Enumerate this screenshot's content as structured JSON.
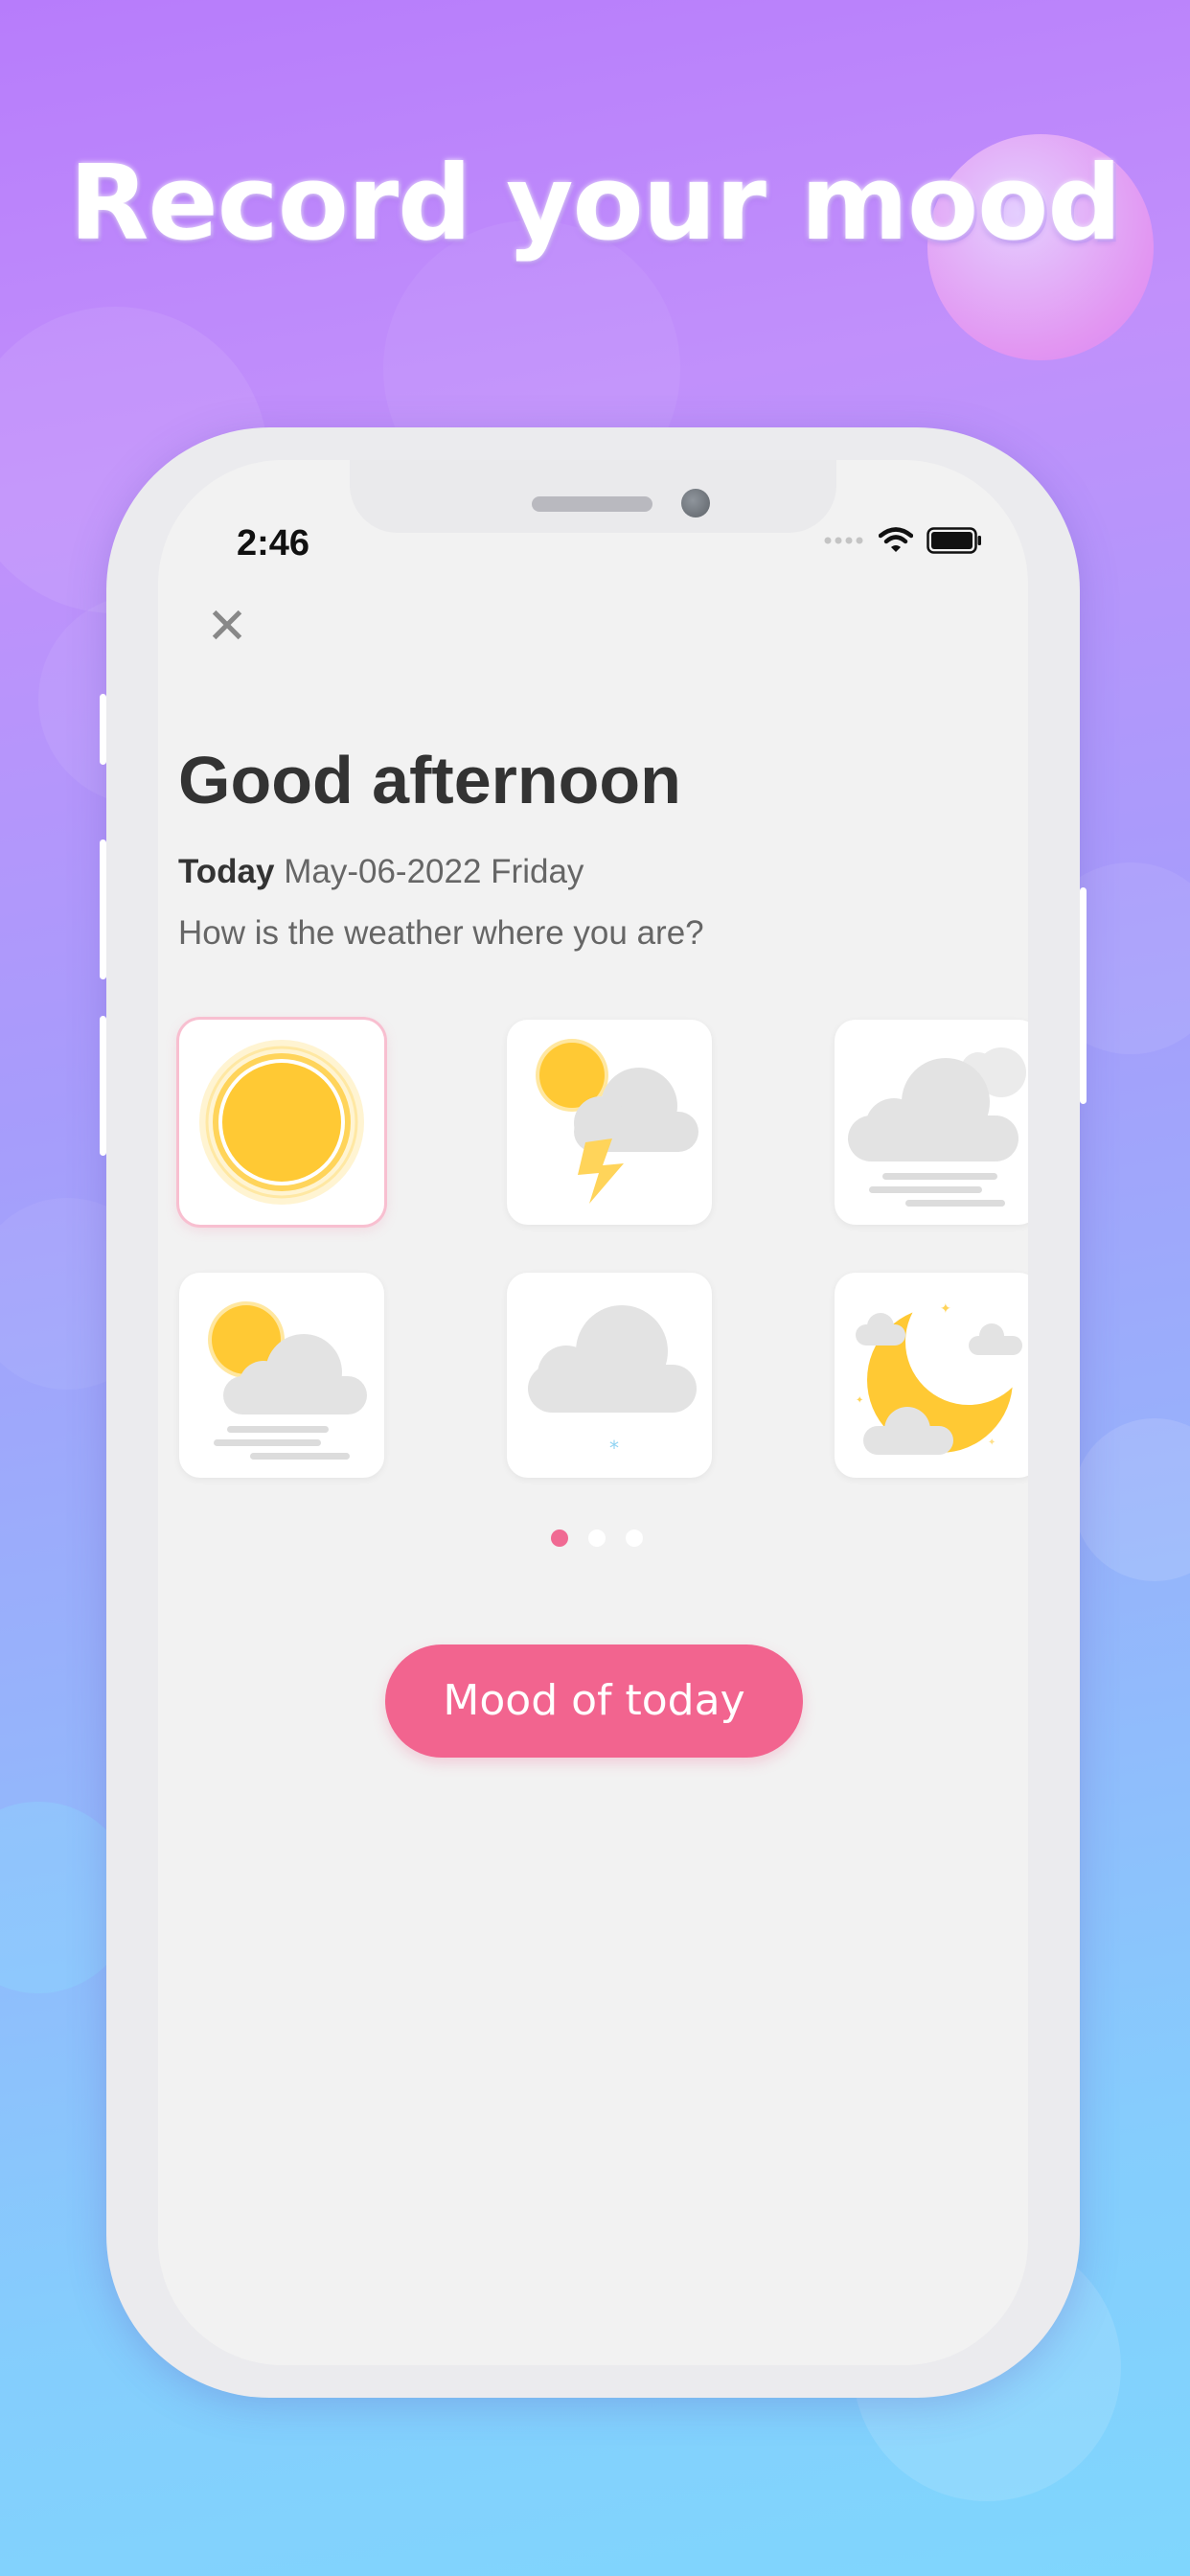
{
  "headline": "Record your mood",
  "status_bar": {
    "time": "2:46"
  },
  "screen": {
    "close_icon": "close-icon",
    "greeting": "Good afternoon",
    "date_prefix": "Today",
    "date_text": "May-06-2022 Friday",
    "question": "How is the weather where you are?",
    "weather_options": [
      {
        "icon": "sunny-icon",
        "selected": true
      },
      {
        "icon": "thunderstorm-icon",
        "selected": false
      },
      {
        "icon": "fog-icon",
        "selected": false
      },
      {
        "icon": "partly-cloudy-fog-icon",
        "selected": false
      },
      {
        "icon": "snow-icon",
        "selected": false
      },
      {
        "icon": "clear-night-icon",
        "selected": false
      }
    ],
    "pagination": {
      "pages": 3,
      "active_page": 1
    },
    "cta_label": "Mood of today"
  },
  "colors": {
    "accent": "#f2648f",
    "sun": "#ffc934",
    "cloud": "#e3e3e3"
  }
}
